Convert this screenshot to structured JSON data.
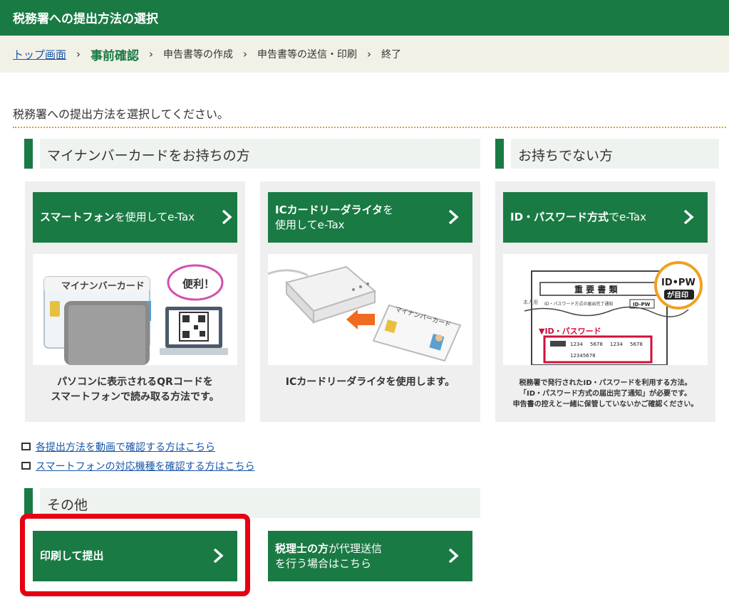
{
  "header": {
    "title": "税務署への提出方法の選択"
  },
  "breadcrumb": {
    "home": "トップ画面",
    "sep": "›",
    "current": "事前確認",
    "step3": "申告書等の作成",
    "step4": "申告書等の送信・印刷",
    "step5": "終了"
  },
  "intro": "税務署への提出方法を選択してください。",
  "sections": {
    "mynumber": "マイナンバーカードをお持ちの方",
    "nocard": "お持ちでない方",
    "other": "その他"
  },
  "cards": [
    {
      "btn_bold": "スマートフォン",
      "btn_rest": "を使用してe-Tax",
      "illus": {
        "card_title": "マイナンバーカード",
        "bubble": "便利！"
      },
      "desc1": "パソコンに表示されるQRコードを",
      "desc2": "スマートフォンで読み取る方法です。"
    },
    {
      "btn_bold": "ICカードリーダライタ",
      "btn_rest1": "を",
      "btn_rest2": "使用してe-Tax",
      "illus": {
        "card_title": "マイナンバーカード"
      },
      "desc1": "ICカードリーダライタを使用します。"
    },
    {
      "btn_bold": "ID・パスワード方式",
      "btn_rest": "でe-Tax",
      "illus": {
        "doc_title": "重 要 書 類",
        "doc_sub": "ID・パスワード方式の届出完了通知",
        "badge_small": "ID-PW",
        "stamp1": "ID•PW",
        "stamp2": "が目印",
        "idpw_label": "▼ID・パスワード",
        "nums": [
          "1234",
          "5678",
          "1234",
          "5678"
        ],
        "num2": "12345678",
        "side": "本人用"
      },
      "desc1": "税務署で発行されたID・パスワードを利用する方法。",
      "desc2": "「ID・パスワード方式の届出完了通知」が必要です。",
      "desc3": "申告書の控えと一緒に保管していないかご確認ください。"
    }
  ],
  "links": [
    "各提出方法を動画で確認する方はこちら",
    "スマートフォンの対応機種を確認する方はこちら"
  ],
  "other_buttons": {
    "print": "印刷して提出",
    "tax_bold": "税理士の方",
    "tax_rest1": "が代理送信",
    "tax_rest2": "を行う場合はこちら"
  },
  "colors": {
    "primary": "#1a7a44",
    "highlight": "#e50012",
    "link": "#1a56a8"
  }
}
